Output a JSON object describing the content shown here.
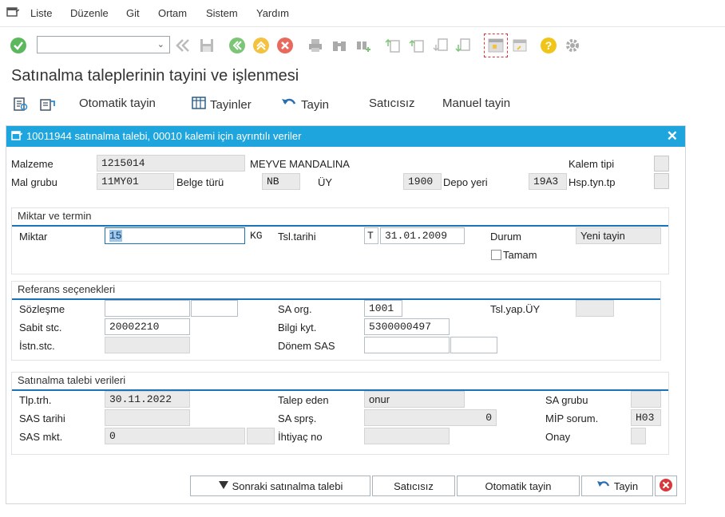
{
  "menubar": {
    "items": [
      "Liste",
      "Düzenle",
      "Git",
      "Ortam",
      "Sistem",
      "Yardım"
    ]
  },
  "toolbar": {
    "command_field_value": "",
    "icons": [
      "check-icon",
      "save-icon",
      "back-icon",
      "exit-icon",
      "cancel-icon",
      "print-icon",
      "find-icon",
      "find-next-icon",
      "first-page-icon",
      "previous-page-icon",
      "next-page-icon",
      "last-page-icon",
      "create-session-icon",
      "shortcut-icon",
      "help-icon",
      "settings-icon"
    ]
  },
  "page": {
    "title": "Satınalma taleplerinin tayini ve işlenmesi"
  },
  "app_toolbar": {
    "auto_assign": "Otomatik tayin",
    "assignments": "Tayinler",
    "assign": "Tayin",
    "no_vendor": "Satıcısız",
    "manual_assign": "Manuel tayin"
  },
  "dialog": {
    "title": "10011944 satınalma talebi, 00010 kalemi için ayrıntılı veriler",
    "header": {
      "material_label": "Malzeme",
      "material_value": "1215014",
      "material_desc": "MEYVE MANDALINA",
      "item_category_label": "Kalem tipi",
      "item_category_value": "",
      "material_group_label": "Mal grubu",
      "material_group_value": "11MY01",
      "doc_type_label": "Belge türü",
      "doc_type_value": "NB",
      "plant_label": "ÜY",
      "plant_value": "1900",
      "storage_label": "Depo yeri",
      "storage_value": "19A3",
      "acct_assign_label": "Hsp.tyn.tp",
      "acct_assign_value": ""
    },
    "quantity_group": {
      "title": "Miktar ve termin",
      "quantity_label": "Miktar",
      "quantity_value": "15",
      "unit": "KG",
      "delivery_date_label": "Tsl.tarihi",
      "delivery_date_type": "T",
      "delivery_date_value": "31.01.2009",
      "status_label": "Durum",
      "status_value": "Yeni tayin",
      "complete_label": "Tamam",
      "complete_checked": false
    },
    "reference_group": {
      "title": "Referans seçenekleri",
      "contract_label": "Sözleşme",
      "contract_value": "",
      "contract_item_value": "",
      "fixed_vendor_label": "Sabit stc.",
      "fixed_vendor_value": "20002210",
      "desired_vendor_label": "İstn.stc.",
      "desired_vendor_value": "",
      "purch_org_label": "SA org.",
      "purch_org_value": "1001",
      "info_record_label": "Bilgi kyt.",
      "info_record_value": "5300000497",
      "outline_agreement_label": "Dönem SAS",
      "outline_agreement_value": "",
      "outline_agreement_item_value": "",
      "supplying_plant_label": "Tsl.yap.ÜY",
      "supplying_plant_value": ""
    },
    "requisition_group": {
      "title": "Satınalma talebi verileri",
      "req_date_label": "Tlp.trh.",
      "req_date_value": "30.11.2022",
      "po_date_label": "SAS tarihi",
      "po_date_value": "",
      "po_qty_label": "SAS mkt.",
      "po_qty_value": "0",
      "po_qty_unit": "",
      "requester_label": "Talep eden",
      "requester_value": "onur",
      "po_orders_label": "SA sprş.",
      "po_orders_value": "0",
      "tracking_no_label": "İhtiyaç no",
      "tracking_no_value": "",
      "purch_group_label": "SA grubu",
      "purch_group_value": "",
      "mrp_controller_label": "MİP sorum.",
      "mrp_controller_value": "H03",
      "release_label": "Onay",
      "release_value": ""
    },
    "buttons": {
      "next_requisition": "Sonraki satınalma talebi",
      "no_vendor": "Satıcısız",
      "auto_assign": "Otomatik tayin",
      "assign": "Tayin"
    }
  },
  "colors": {
    "dialog_header": "#1ea5dd",
    "group_line": "#1a73b8",
    "check_green": "#5cb85c",
    "cancel_red": "#d9383a",
    "help_yellow": "#f0c419"
  }
}
